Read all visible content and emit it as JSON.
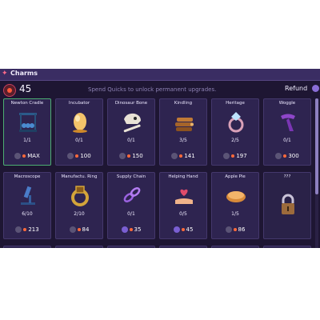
{
  "window": {
    "title": "Charms",
    "title_icon": "charm-icon",
    "quicks": "45",
    "hint": "Spend Quicks to unlock permanent upgrades.",
    "refund_label": "Refund"
  },
  "cards": [
    {
      "name": "Newton Cradle",
      "icon": "newton-cradle-icon",
      "level": "1/1",
      "price": "MAX",
      "owned": true
    },
    {
      "name": "Incubator",
      "icon": "egg-icon",
      "level": "0/1",
      "price": "100"
    },
    {
      "name": "Dinosaur Bone",
      "icon": "dinosaur-skull-icon",
      "level": "0/1",
      "price": "150"
    },
    {
      "name": "Kindling",
      "icon": "firewood-icon",
      "level": "3/5",
      "price": "141"
    },
    {
      "name": "Heritage",
      "icon": "ring-icon",
      "level": "2/5",
      "price": "197"
    },
    {
      "name": "Woggle",
      "icon": "scarf-icon",
      "level": "0/1",
      "price": "300"
    },
    {
      "name": "Macroscope",
      "icon": "microscope-icon",
      "level": "6/10",
      "price": "213"
    },
    {
      "name": "Manufactu. Ring",
      "icon": "gold-ring-icon",
      "level": "2/10",
      "price": "84"
    },
    {
      "name": "Supply Chain",
      "icon": "chain-icon",
      "level": "0/1",
      "price": "35",
      "plus": true
    },
    {
      "name": "Helping Hand",
      "icon": "heart-hand-icon",
      "level": "0/5",
      "price": "45",
      "plus": true
    },
    {
      "name": "Apple Pie",
      "icon": "pie-icon",
      "level": "1/5",
      "price": "86"
    },
    {
      "name": "???",
      "icon": "padlock-icon",
      "level": "",
      "price": "",
      "locked": true
    }
  ],
  "colors": {
    "owned_border": "#4cae72",
    "accent": "#8a6dd6",
    "quick": "#ff6a3a"
  }
}
